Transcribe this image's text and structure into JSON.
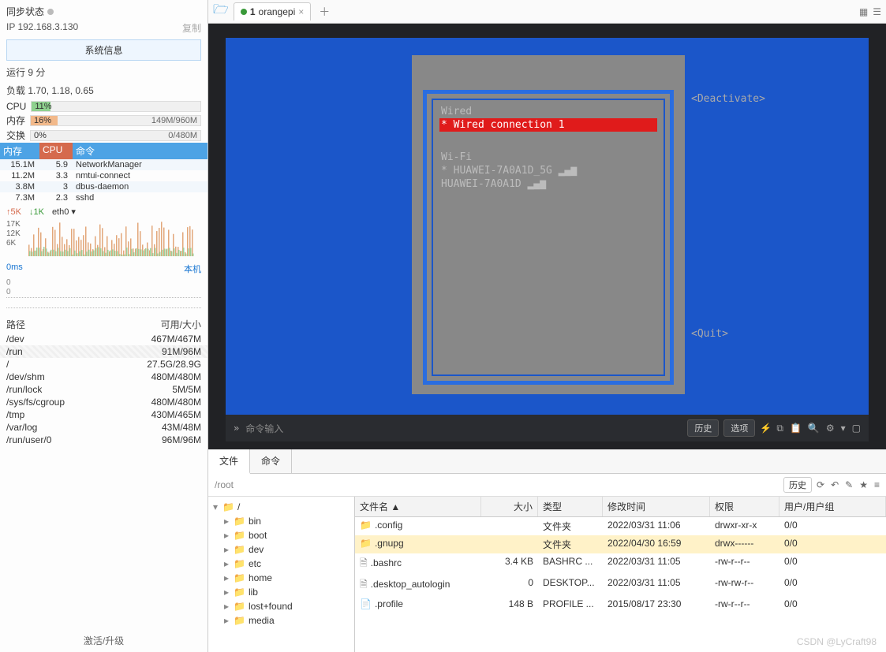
{
  "sidebar": {
    "status_label": "同步状态",
    "ip": "IP 192.168.3.130",
    "copy": "复制",
    "sysinfo_btn": "系统信息",
    "uptime": "运行 9 分",
    "load": "负载 1.70, 1.18, 0.65",
    "cpu_label": "CPU",
    "cpu_pct": "11%",
    "mem_label": "内存",
    "mem_pct": "16%",
    "mem_txt": "149M/960M",
    "swap_label": "交换",
    "swap_pct": "0%",
    "swap_txt": "0/480M",
    "proc_cols": {
      "mem": "内存",
      "cpu": "CPU",
      "cmd": "命令"
    },
    "procs": [
      {
        "mem": "15.1M",
        "cpu": "5.9",
        "cmd": "NetworkManager"
      },
      {
        "mem": "11.2M",
        "cpu": "3.3",
        "cmd": "nmtui-connect"
      },
      {
        "mem": "3.8M",
        "cpu": "3",
        "cmd": "dbus-daemon"
      },
      {
        "mem": "7.3M",
        "cpu": "2.3",
        "cmd": "sshd"
      }
    ],
    "net_up": "↑5K",
    "net_down": "↓1K",
    "net_if": "eth0 ▾",
    "chart_y": [
      "17K",
      "12K",
      "6K"
    ],
    "lat": "0ms",
    "lat_host": "本机",
    "lat_zeros": [
      "0",
      "0"
    ],
    "fs_head_path": "路径",
    "fs_head_size": "可用/大小",
    "fs": [
      {
        "p": "/dev",
        "s": "467M/467M"
      },
      {
        "p": "/run",
        "s": "91M/96M"
      },
      {
        "p": "/",
        "s": "27.5G/28.9G"
      },
      {
        "p": "/dev/shm",
        "s": "480M/480M"
      },
      {
        "p": "/run/lock",
        "s": "5M/5M"
      },
      {
        "p": "/sys/fs/cgroup",
        "s": "480M/480M"
      },
      {
        "p": "/tmp",
        "s": "430M/465M"
      },
      {
        "p": "/var/log",
        "s": "43M/48M"
      },
      {
        "p": "/run/user/0",
        "s": "96M/96M"
      }
    ],
    "activate": "激活/升级"
  },
  "tabs": {
    "tab1_num": "1",
    "tab1_name": "orangepi"
  },
  "nmtui": {
    "wired_hdr": "Wired",
    "wired_conn": "* Wired connection 1",
    "wifi_hdr": "Wi-Fi",
    "wifi1": "* HUAWEI-7A0A1D_5G",
    "wifi2": "  HUAWEI-7A0A1D",
    "deactivate": "<Deactivate>",
    "quit": "<Quit>"
  },
  "cmdbar": {
    "prompt": "»",
    "placeholder": "命令输入",
    "history": "历史",
    "options": "选项"
  },
  "filetabs": {
    "t1": "文件",
    "t2": "命令"
  },
  "path": "/root",
  "path_history": "历史",
  "tree_root": "/",
  "tree": [
    "bin",
    "boot",
    "dev",
    "etc",
    "home",
    "lib",
    "lost+found",
    "media"
  ],
  "cols": {
    "name": "文件名 ▲",
    "size": "大小",
    "type": "类型",
    "date": "修改时间",
    "perm": "权限",
    "own": "用户/用户组"
  },
  "files": [
    {
      "icon": "folder",
      "name": ".config",
      "size": "",
      "type": "文件夹",
      "date": "2022/03/31 11:06",
      "perm": "drwxr-xr-x",
      "own": "0/0",
      "sel": false
    },
    {
      "icon": "folder",
      "name": ".gnupg",
      "size": "",
      "type": "文件夹",
      "date": "2022/04/30 16:59",
      "perm": "drwx------",
      "own": "0/0",
      "sel": true
    },
    {
      "icon": "file",
      "name": ".bashrc",
      "size": "3.4 KB",
      "type": "BASHRC ...",
      "date": "2022/03/31 11:05",
      "perm": "-rw-r--r--",
      "own": "0/0",
      "sel": false
    },
    {
      "icon": "file",
      "name": ".desktop_autologin",
      "size": "0",
      "type": "DESKTOP...",
      "date": "2022/03/31 11:05",
      "perm": "-rw-rw-r--",
      "own": "0/0",
      "sel": false
    },
    {
      "icon": "file-blue",
      "name": ".profile",
      "size": "148 B",
      "type": "PROFILE ...",
      "date": "2015/08/17 23:30",
      "perm": "-rw-r--r--",
      "own": "0/0",
      "sel": false
    }
  ],
  "watermark": "CSDN @LyCraft98"
}
